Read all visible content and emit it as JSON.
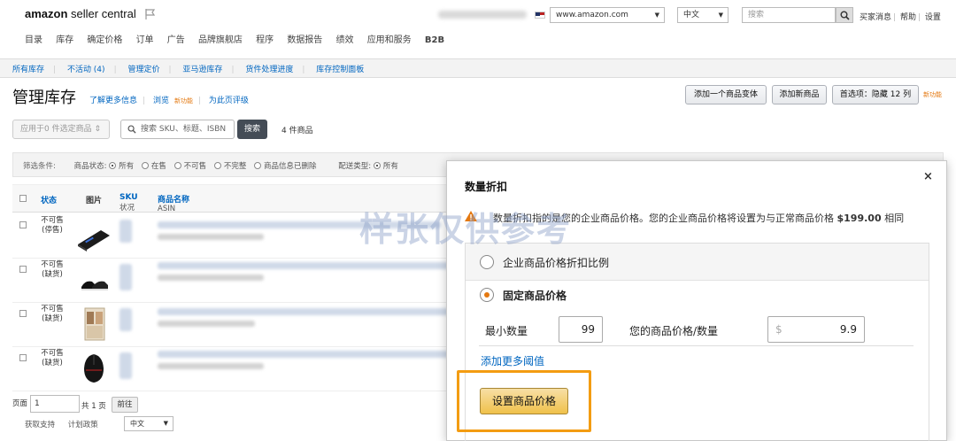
{
  "header": {
    "logo_brand": "amazon",
    "logo_product": " seller central",
    "marketplace": "www.amazon.com",
    "language": "中文",
    "search_placeholder": "搜索",
    "links": [
      "买家消息",
      "帮助",
      "设置"
    ]
  },
  "main_nav": [
    "目录",
    "库存",
    "确定价格",
    "订单",
    "广告",
    "品牌旗舰店",
    "程序",
    "数据报告",
    "绩效",
    "应用和服务",
    "B2B"
  ],
  "sub_nav": [
    "所有库存",
    "不活动 (4)",
    "管理定价",
    "亚马逊库存",
    "货件处理进度",
    "库存控制面板"
  ],
  "page": {
    "title": "管理库存",
    "learn_more": "了解更多信息",
    "browse": "浏览",
    "new_tag": "新功能",
    "rate_page": "为此页评级",
    "add_variant": "添加一个商品变体",
    "add_product": "添加新商品",
    "preferences": "首选项：隐藏 12 列",
    "new_feature": "新功能"
  },
  "actions": {
    "apply_placeholder": "应用于0 件选定商品",
    "search_placeholder": "搜索 SKU、标题、ISBN",
    "search_button": "搜索",
    "count": "4 件商品"
  },
  "filters": {
    "label": "筛选条件:",
    "status_label": "商品状态:",
    "status_options": [
      "所有",
      "在售",
      "不可售",
      "不完整",
      "商品信息已删除"
    ],
    "fulfillment_label": "配送类型:",
    "fulfillment_options": [
      "所有"
    ]
  },
  "table": {
    "headers": {
      "status": "状态",
      "image": "图片",
      "sku": "SKU",
      "sku_sub": "状况",
      "name": "商品名称",
      "name_sub": "ASIN"
    },
    "rows": [
      {
        "status": "不可售 (停售)"
      },
      {
        "status": "不可售 (缺货)"
      },
      {
        "status": "不可售 (缺货)"
      },
      {
        "status": "不可售 (缺货)"
      }
    ]
  },
  "pagination": {
    "page_label": "页面",
    "page_value": "1",
    "total": "共 1 页",
    "go": "前往"
  },
  "footer": {
    "links": [
      "获取支持",
      "计划政策"
    ],
    "language": "中文"
  },
  "watermark": "样张仅供参考",
  "popover": {
    "title": "数量折扣",
    "close": "×",
    "warning_text": "数量折扣指的是您的企业商品价格。您的企业商品价格将设置为与正常商品价格 ",
    "warning_price": "$199.00",
    "warning_suffix": " 相同",
    "option_percent": "企业商品价格折扣比例",
    "option_fixed": "固定商品价格",
    "min_qty_label": "最小数量",
    "min_qty_value": "99",
    "price_label": "您的商品价格/数量",
    "currency": "$",
    "price_value": "9.9",
    "add_more": "添加更多阈值",
    "submit": "设置商品价格"
  }
}
